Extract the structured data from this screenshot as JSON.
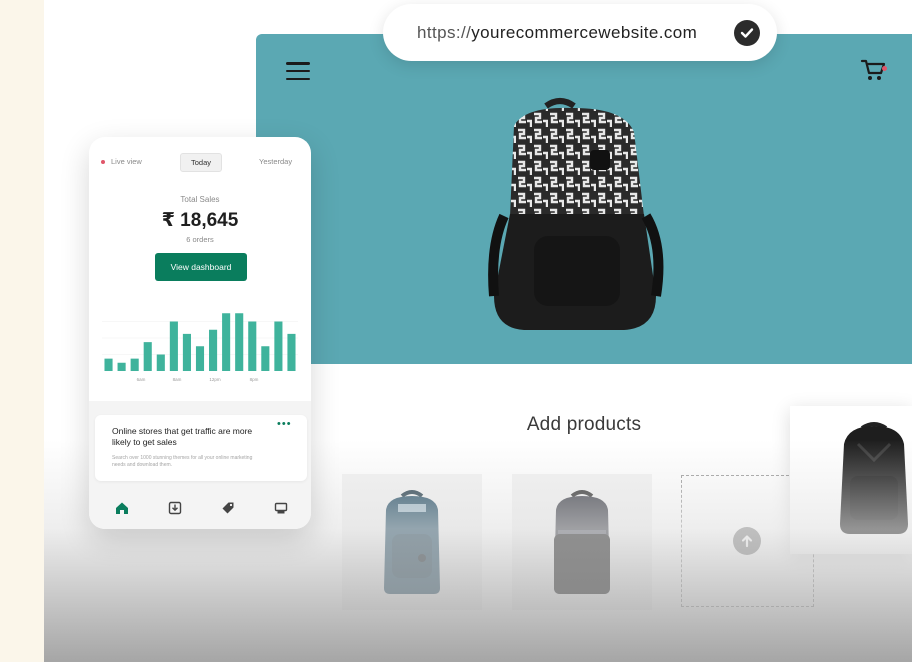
{
  "url_bar": {
    "protocol": "https://",
    "domain": "yourecommercewebsite.com",
    "verified_icon": "check-circle-icon"
  },
  "storefront": {
    "menu_icon": "hamburger-menu-icon",
    "cart_icon": "shopping-cart-icon",
    "hero_color": "#5ba8b3",
    "add_products_title": "Add products",
    "upload_icon": "arrow-up-circle-icon"
  },
  "dashboard": {
    "live_view_label": "Live view",
    "today_label": "Today",
    "yesterday_label": "Yesterday",
    "total_sales_label": "Total Sales",
    "total_sales_value": "₹ 18,645",
    "orders_label": "6 orders",
    "view_dashboard_label": "View dashboard",
    "accent_color": "#0a7d5d",
    "card": {
      "title": "Online stores that get traffic are more likely to get sales",
      "description": "Search over 1000 stunning themes for all your online marketing needs and download them.",
      "more_icon": "more-dots-icon"
    },
    "tabs": [
      {
        "icon": "home-icon"
      },
      {
        "icon": "download-icon"
      },
      {
        "icon": "tag-icon"
      },
      {
        "icon": "store-icon"
      }
    ]
  },
  "chart_data": {
    "type": "bar",
    "color": "#3fb39c",
    "values": [
      3,
      2,
      3,
      7,
      4,
      12,
      9,
      6,
      10,
      14,
      14,
      12,
      6,
      12,
      9
    ],
    "tick_labels": [
      "6am",
      "8am",
      "12pm",
      "8pm"
    ],
    "ylim": [
      0,
      16
    ]
  }
}
